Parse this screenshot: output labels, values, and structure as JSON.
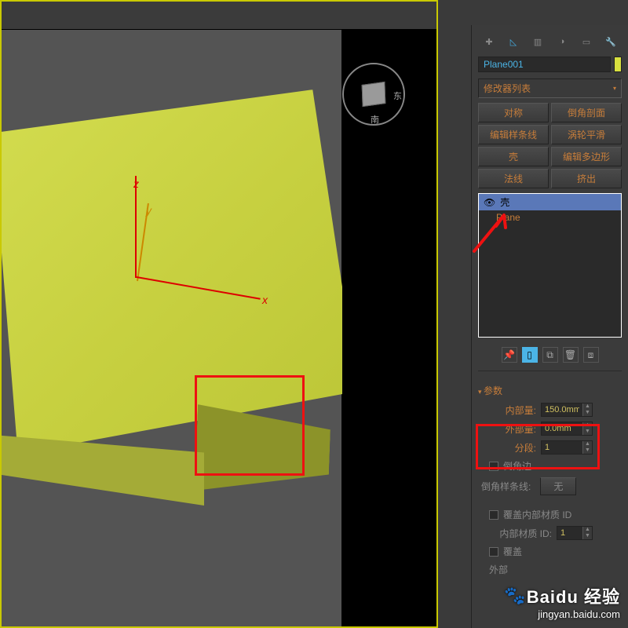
{
  "viewport": {
    "axes": {
      "x": "x",
      "y": "y",
      "z": "z"
    },
    "viewcube": {
      "right": "东",
      "front": "南"
    }
  },
  "panel": {
    "object_name": "Plane001",
    "modifier_dropdown": "修改器列表",
    "buttons": {
      "symmetry": "对称",
      "chamfer_face": "倒角剖面",
      "edit_spline": "编辑样条线",
      "turbo_smooth": "涡轮平滑",
      "shell": "壳",
      "edit_poly": "编辑多边形",
      "normal": "法线",
      "extrude": "挤出"
    },
    "stack": {
      "top": "壳",
      "base": "Plane"
    },
    "section_params": "参数",
    "params": {
      "inner_label": "内部量:",
      "inner_value": "150.0mm",
      "outer_label": "外部量:",
      "outer_value": "0.0mm",
      "segments_label": "分段:",
      "segments_value": "1"
    },
    "bevel_edges_chk": "倒角边",
    "bevel_spline_label": "倒角样条线:",
    "none_btn": "无",
    "override_inner_mat_chk": "覆盖内部材质 ID",
    "inner_mat_label": "内部材质 ID:",
    "inner_mat_value": "1",
    "override_outer_chk": "覆盖",
    "outer_mat_label": "外部"
  },
  "watermark": {
    "brand": "Baidu 经验",
    "url": "jingyan.baidu.com"
  }
}
